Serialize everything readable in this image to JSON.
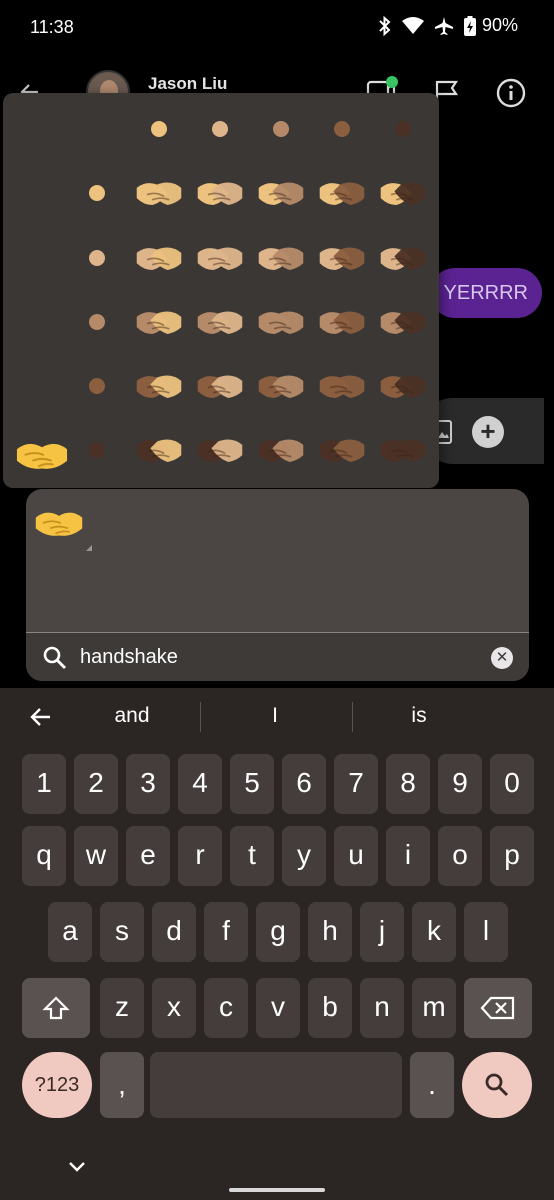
{
  "status": {
    "time": "11:38",
    "battery": "90%",
    "icons": [
      "bluetooth-icon",
      "wifi-icon",
      "airplane-icon",
      "battery-charging-icon"
    ]
  },
  "chat": {
    "contact_name": "Jason Liu",
    "bubble_text": "YERRRR",
    "header_icons": [
      "back-arrow-icon",
      "video-call-icon",
      "label-icon",
      "info-icon"
    ]
  },
  "emoji": {
    "base": "handshake",
    "result_count": 1,
    "skin_tones": [
      "#ecc27e",
      "#deb58b",
      "#b58a69",
      "#8a5e3f",
      "#4a3025"
    ]
  },
  "search": {
    "query": "handshake"
  },
  "keyboard": {
    "suggestions": [
      "and",
      "I",
      "is"
    ],
    "row_numbers": [
      "1",
      "2",
      "3",
      "4",
      "5",
      "6",
      "7",
      "8",
      "9",
      "0"
    ],
    "row_top": [
      "q",
      "w",
      "e",
      "r",
      "t",
      "y",
      "u",
      "i",
      "o",
      "p"
    ],
    "row_home": [
      "a",
      "s",
      "d",
      "f",
      "g",
      "h",
      "j",
      "k",
      "l"
    ],
    "row_bottom": [
      "z",
      "x",
      "c",
      "v",
      "b",
      "n",
      "m"
    ],
    "sym_label": "?123",
    "comma": ",",
    "period": "."
  },
  "colors": {
    "accent_bubble": "#5b2391",
    "action_key": "#f0c9c0"
  }
}
